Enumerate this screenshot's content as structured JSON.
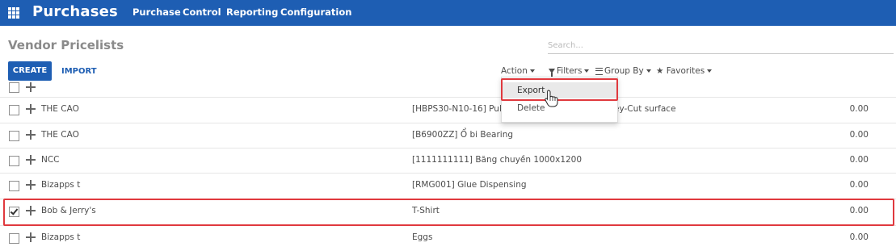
{
  "navbar": {
    "title": "Purchases",
    "menu": [
      "Purchase",
      "Control",
      "Reporting",
      "Configuration"
    ]
  },
  "control_panel": {
    "breadcrumb": "Vendor Pricelists",
    "search_placeholder": "Search...",
    "create_label": "CREATE",
    "import_label": "IMPORT",
    "action_label": "Action",
    "filters_label": "Filters",
    "groupby_label": "Group By",
    "favorites_label": "Favorites"
  },
  "action_menu": {
    "items": [
      "Export",
      "Delete"
    ],
    "highlighted": "Export"
  },
  "rows": [
    {
      "vendor": "",
      "product": "",
      "price": "",
      "checked": false
    },
    {
      "vendor": "THE CAO",
      "product": "[HBPS30-N10-16] Puli t",
      "product_tail": "ey-Cut surface",
      "price": "0.00",
      "checked": false
    },
    {
      "vendor": "THE CAO",
      "product": "[B6900ZZ] Ổ bi Bearing",
      "price": "0.00",
      "checked": false
    },
    {
      "vendor": "NCC",
      "product": "[1111111111] Băng chuyền 1000x1200",
      "price": "0.00",
      "checked": false
    },
    {
      "vendor": "Bizapps t",
      "product": "[RMG001] Glue Dispensing",
      "price": "0.00",
      "checked": false
    },
    {
      "vendor": "Bob & Jerry's",
      "product": "T-Shirt",
      "price": "0.00",
      "checked": true
    },
    {
      "vendor": "Bizapps t",
      "product": "Eggs",
      "price": "0.00",
      "checked": false
    }
  ],
  "colors": {
    "navbar": "#1e5eb3",
    "highlight": "#e0393e"
  }
}
